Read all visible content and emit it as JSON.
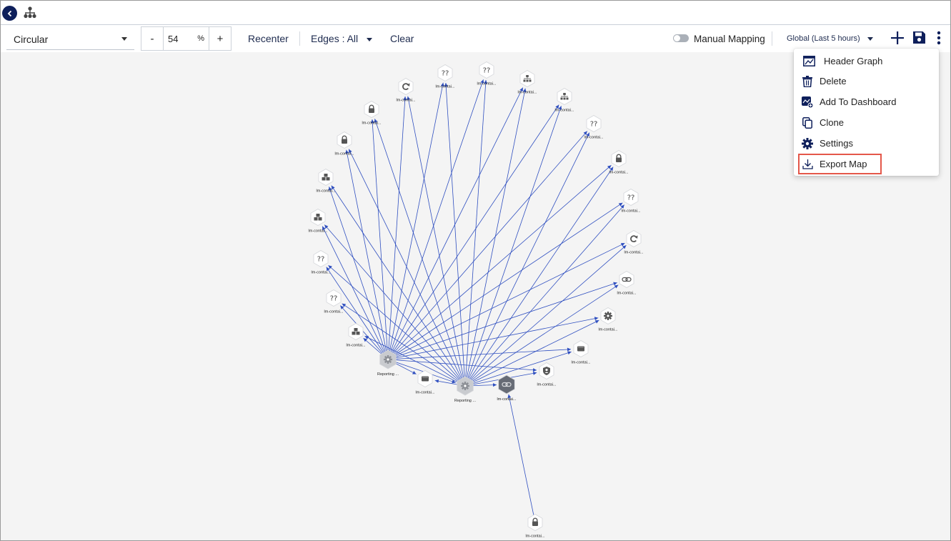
{
  "toolbar": {
    "layout_value": "Circular",
    "zoom_minus": "-",
    "zoom_value": "54",
    "zoom_unit": "%",
    "zoom_plus": "+",
    "recenter": "Recenter",
    "edges": "Edges : All",
    "clear": "Clear",
    "manual_mapping": "Manual Mapping",
    "manual_mapping_on": false,
    "time_range": "Global (Last 5 hours)"
  },
  "menu": {
    "items": [
      {
        "label": "Header Graph",
        "icon": "header-graph-icon"
      },
      {
        "label": "Delete",
        "icon": "trash-icon"
      },
      {
        "label": "Add To Dashboard",
        "icon": "dashboard-add-icon"
      },
      {
        "label": "Clone",
        "icon": "copy-icon"
      },
      {
        "label": "Settings",
        "icon": "gear-icon"
      },
      {
        "label": "Export Map",
        "icon": "download-icon",
        "highlighted": true
      }
    ]
  },
  "colors": {
    "edge": "#2f4fc0",
    "nav_dark": "#0e1f5b",
    "highlight": "#e4574a",
    "canvas_bg": "#f4f4f4"
  },
  "graph": {
    "hubs": [
      {
        "label": "Reporting ...",
        "icon": "gear-icon"
      },
      {
        "label": "Reporting ...",
        "icon": "gear-icon"
      },
      {
        "label": "lm-contai...",
        "icon": "link-icon"
      }
    ],
    "nodes": [
      {
        "label": "lm-contai...",
        "icon": "question-icon"
      },
      {
        "label": "lm-contai...",
        "icon": "question-icon"
      },
      {
        "label": "lm-contai...",
        "icon": "sitemap-icon"
      },
      {
        "label": "lm-contai...",
        "icon": "sitemap-icon"
      },
      {
        "label": "lm-contai...",
        "icon": "question-icon"
      },
      {
        "label": "lm-contai...",
        "icon": "lock-icon"
      },
      {
        "label": "lm-contai...",
        "icon": "question-icon"
      },
      {
        "label": "lm-contai...",
        "icon": "refresh-icon"
      },
      {
        "label": "lm-contai...",
        "icon": "link-icon"
      },
      {
        "label": "lm-contai...",
        "icon": "gear-icon"
      },
      {
        "label": "lm-contai...",
        "icon": "container-icon"
      },
      {
        "label": "lm-contai...",
        "icon": "shield-user-icon"
      },
      {
        "label": "lm-contai...",
        "icon": "container-icon"
      },
      {
        "label": "lm-contai...",
        "icon": "cubes-icon"
      },
      {
        "label": "lm-contai...",
        "icon": "question-icon"
      },
      {
        "label": "lm-contai...",
        "icon": "question-icon"
      },
      {
        "label": "lm-contai...",
        "icon": "cubes-icon"
      },
      {
        "label": "lm-contai...",
        "icon": "cubes-icon"
      },
      {
        "label": "lm-contai...",
        "icon": "lock-icon"
      },
      {
        "label": "lm-contai...",
        "icon": "lock-icon"
      },
      {
        "label": "lm-contai...",
        "icon": "refresh-icon"
      },
      {
        "label": "lm-contai...",
        "icon": "lock-icon"
      }
    ]
  }
}
